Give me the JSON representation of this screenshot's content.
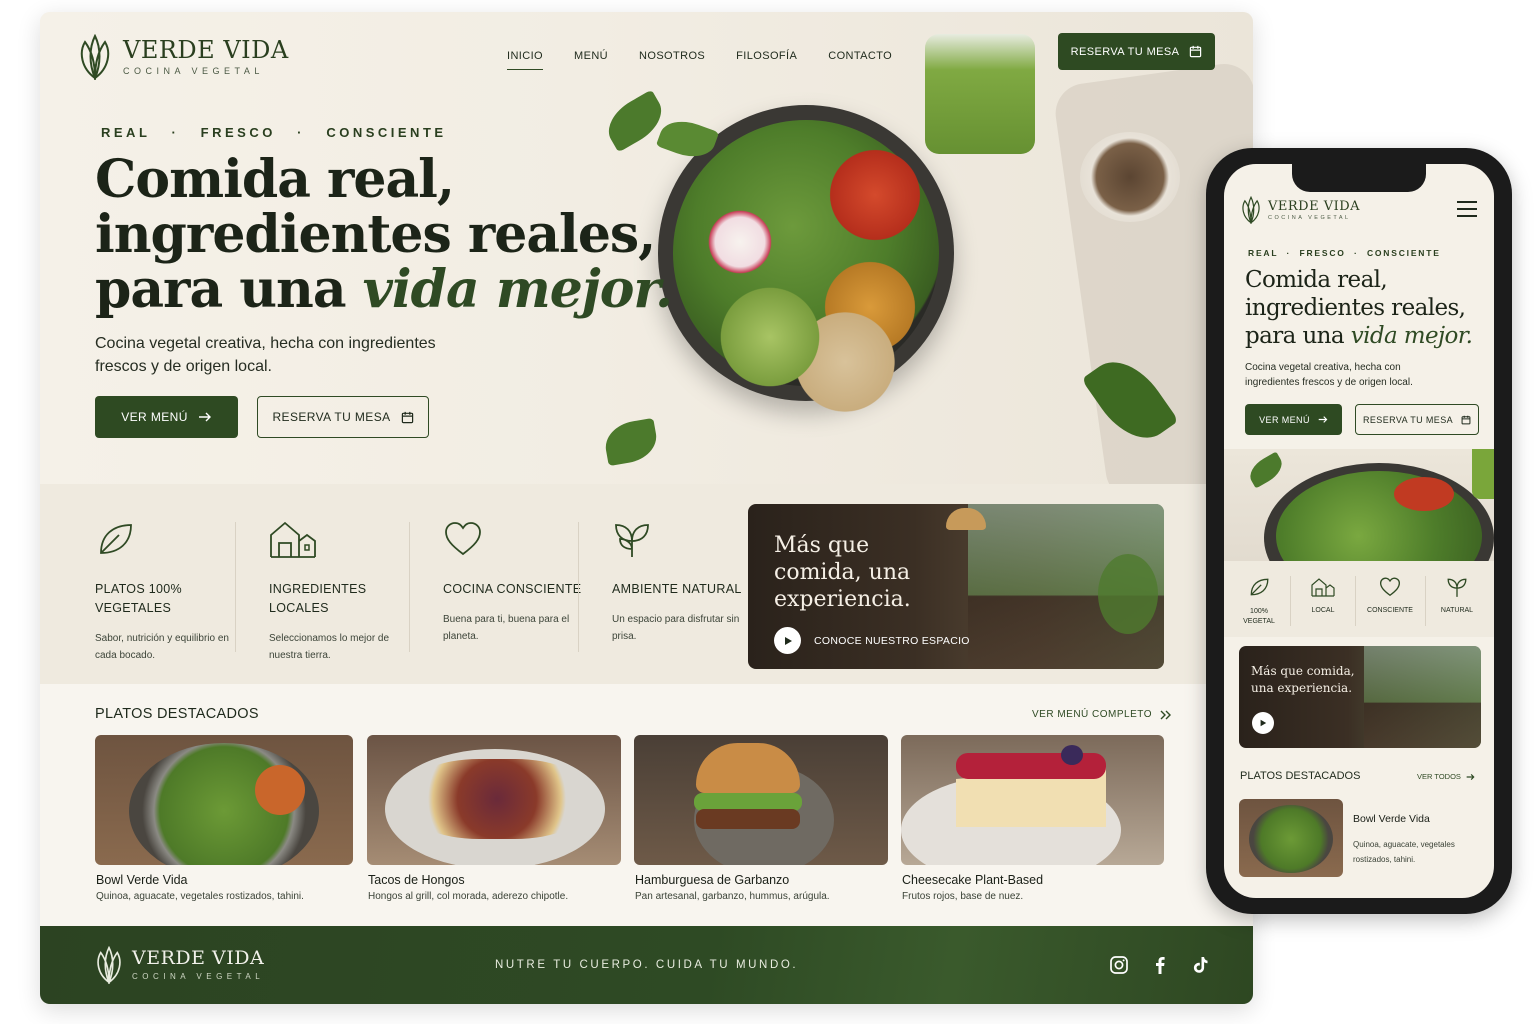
{
  "brand": {
    "name": "VERDE VIDA",
    "subtitle": "COCINA VEGETAL"
  },
  "nav": {
    "items": [
      {
        "label": "INICIO",
        "active": true
      },
      {
        "label": "MENÚ"
      },
      {
        "label": "NOSOTROS"
      },
      {
        "label": "FILOSOFÍA"
      },
      {
        "label": "CONTACTO"
      }
    ],
    "cta": "RESERVA TU MESA"
  },
  "hero": {
    "tagline": "REAL   ·   FRESCO   ·   CONSCIENTE",
    "headline_line1": "Comida real,",
    "headline_line2": "ingredientes reales,",
    "headline_line3_prefix": "para una ",
    "headline_emphasis": "vida mejor.",
    "lead": "Cocina vegetal creativa, hecha con ingredientes frescos y de origen local.",
    "primary_button": "VER MENÚ",
    "secondary_button": "RESERVA TU MESA"
  },
  "features": [
    {
      "icon": "leaf-icon",
      "title": "PLATOS 100% VEGETALES",
      "text": "Sabor, nutrición y equilibrio en cada bocado."
    },
    {
      "icon": "market-icon",
      "title": "INGREDIENTES LOCALES",
      "text": "Seleccionamos lo mejor de nuestra tierra."
    },
    {
      "icon": "heart-icon",
      "title": "COCINA CONSCIENTE",
      "text": "Buena para ti, buena para el planeta."
    },
    {
      "icon": "sprout-icon",
      "title": "AMBIENTE NATURAL",
      "text": "Un espacio para disfrutar sin prisa."
    }
  ],
  "experience": {
    "title": "Más que comida, una experiencia.",
    "video_label": "CONOCE NUESTRO ESPACIO"
  },
  "featured": {
    "title": "PLATOS DESTACADOS",
    "link": "VER MENÚ COMPLETO",
    "dishes": [
      {
        "name": "Bowl Verde Vida",
        "desc": "Quinoa, aguacate, vegetales rostizados, tahini."
      },
      {
        "name": "Tacos de Hongos",
        "desc": "Hongos al grill, col morada, aderezo chipotle."
      },
      {
        "name": "Hamburguesa de Garbanzo",
        "desc": "Pan artesanal, garbanzo, hummus, arúgula."
      },
      {
        "name": "Cheesecake Plant-Based",
        "desc": "Frutos rojos, base de nuez."
      }
    ]
  },
  "footer": {
    "tagline": "NUTRE TU CUERPO. CUIDA TU MUNDO.",
    "social": [
      "instagram-icon",
      "facebook-icon",
      "tiktok-icon"
    ]
  },
  "mobile": {
    "tagline": "REAL  ·  FRESCO  ·  CONSCIENTE",
    "headline_line1": "Comida real,",
    "headline_line2": "ingredientes reales,",
    "headline_line3_prefix": "para una ",
    "headline_emphasis": "vida mejor.",
    "lead": "Cocina vegetal creativa, hecha con ingredientes frescos y de origen local.",
    "primary_button": "VER MENÚ",
    "secondary_button": "RESERVA TU MESA",
    "features": [
      "100% VEGETAL",
      "LOCAL",
      "CONSCIENTE",
      "NATURAL"
    ],
    "experience_title": "Más que comida, una experiencia.",
    "featured_title": "PLATOS DESTACADOS",
    "featured_link": "VER TODOS",
    "dish": {
      "name": "Bowl Verde Vida",
      "desc": "Quinoa, aguacate, vegetales rostizados, tahini."
    }
  },
  "colors": {
    "primary": "#2e4a22",
    "background": "#f5f1e8",
    "text": "#1f2a1c"
  }
}
